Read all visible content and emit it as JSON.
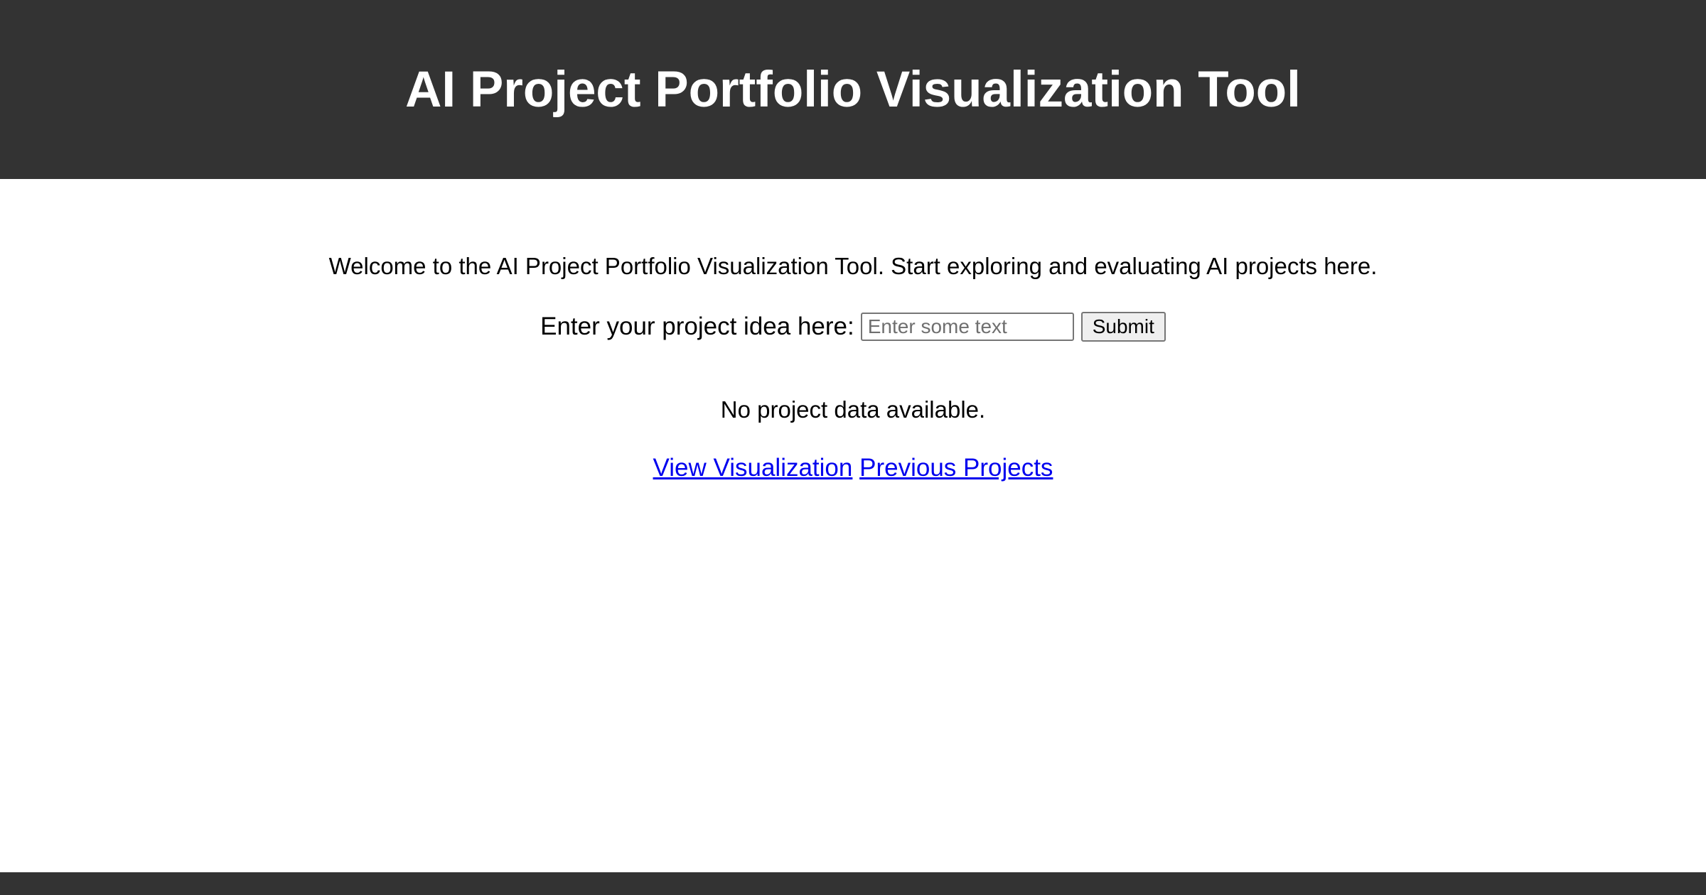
{
  "header": {
    "title": "AI Project Portfolio Visualization Tool"
  },
  "main": {
    "welcome_text": "Welcome to the AI Project Portfolio Visualization Tool. Start exploring and evaluating AI projects here.",
    "form": {
      "label": "Enter your project idea here:",
      "input_placeholder": "Enter some text",
      "input_value": "",
      "submit_label": "Submit"
    },
    "status_text": "No project data available.",
    "links": [
      {
        "label": "View Visualization"
      },
      {
        "label": "Previous Projects"
      }
    ]
  },
  "colors": {
    "header_bg": "#333333",
    "footer_bg": "#333333",
    "link": "#0000ee"
  }
}
